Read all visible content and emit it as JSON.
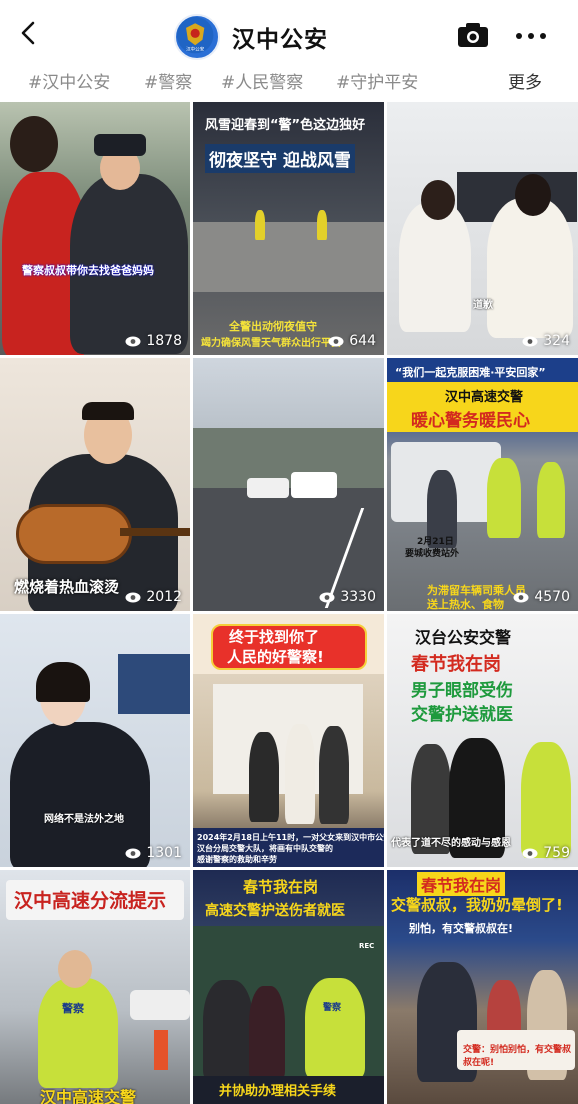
{
  "header": {
    "title": "汉中公安",
    "avatar_text": "汉中公安"
  },
  "tags": [
    "#汉中公安",
    "#警察",
    "#人民警察",
    "#守护平安"
  ],
  "tags_more": "更多",
  "videos": [
    {
      "caption": "警察叔叔带你去找爸爸妈妈",
      "views": "1878"
    },
    {
      "title_top": "风雪迎春到“警”色这边独好",
      "title_main": "彻夜坚守 迎战风雪",
      "subtitle": "全警出动彻夜值守",
      "subtitle2": "竭力确保风雪天气群众出行平安",
      "views": "644"
    },
    {
      "caption": "道歉",
      "views": "324"
    },
    {
      "caption": "燃烧着热血滚烫",
      "views": "2012"
    },
    {
      "views": "3330"
    },
    {
      "banner_top": "“我们一起克服困难·平安回家”",
      "banner1": "汉中高速交警",
      "banner2": "暖心警务暖民心",
      "date": "2月21日",
      "date2": "要城收费站外",
      "bottom1": "为滞留车辆司乘人员",
      "bottom2": "送上热水、食物",
      "views": "4570"
    },
    {
      "caption": "网络不是法外之地",
      "views": "1301"
    },
    {
      "banner1": "终于找到你了",
      "banner2": "人民的好警察!",
      "bottom1": "2024年2月18日上午11时，一对父女来到汉中市公安局",
      "bottom2": "汉台分局交警大队，将画有中队交警的",
      "bottom3": "感谢警察的救助和辛劳",
      "views": ""
    },
    {
      "title_top": "汉台公安交警",
      "title_red": "春节我在岗",
      "title_green": "男子眼部受伤",
      "title_green2": "交警护送就医",
      "bottom": "代表了道不尽的感动与感恩",
      "views": "759"
    },
    {
      "banner": "汉中高速分流提示",
      "vest": "警察",
      "bottom": "汉中高速交警"
    },
    {
      "title_red": "春节我在岗",
      "title_yellow": "高速交警护送伤者就医",
      "bottom": "并协助办理相关手续",
      "rec": "REC",
      "vest": "警察"
    },
    {
      "title_red": "春节我在岗",
      "title_yellow": "交警叔叔，我奶奶晕倒了!",
      "subtitle": "别怕，有交警叔叔在!",
      "bottom": "交警：别怕别怕，有交警叔叔在呢!"
    }
  ],
  "colors": {
    "accent": "#1b6fd8",
    "red": "#d32a1f",
    "yellow": "#f7d61b",
    "green": "#1e9a3d"
  }
}
